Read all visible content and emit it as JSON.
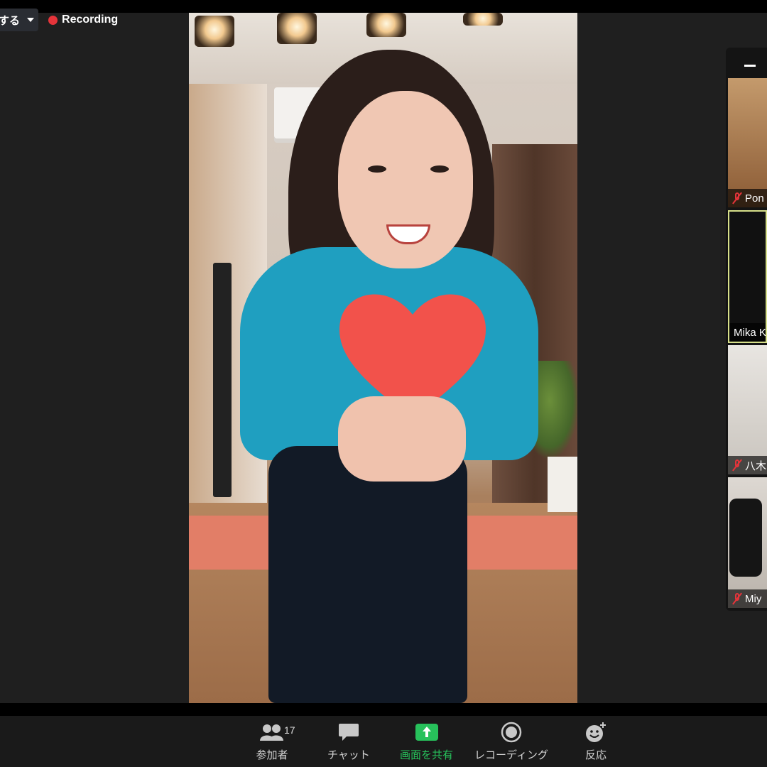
{
  "recording": {
    "stop_label": "する",
    "status_label": "Recording"
  },
  "gallery": {
    "tiles": [
      {
        "name": "Pon"
      },
      {
        "name": "Mika K"
      },
      {
        "name": "八木"
      },
      {
        "name": "Miy"
      }
    ]
  },
  "toolbar": {
    "participants_label": "参加者",
    "participants_count": "17",
    "chat_label": "チャット",
    "share_label": "画面を共有",
    "record_label": "レコーディング",
    "reactions_label": "反応"
  },
  "colors": {
    "recording_red": "#e5343a",
    "share_green": "#27c15b",
    "active_speaker_border": "#d7e08a",
    "toolbar_bg": "#1a1a1a"
  }
}
